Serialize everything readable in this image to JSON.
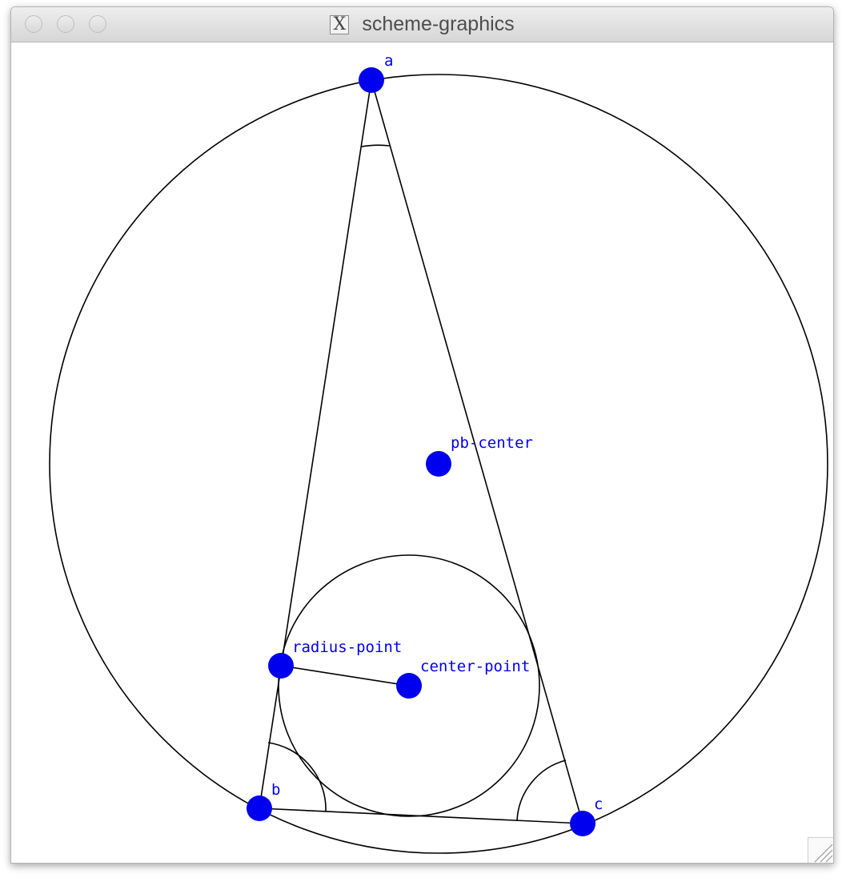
{
  "window": {
    "title": "scheme-graphics"
  },
  "points": {
    "a": "a",
    "b": "b",
    "c": "c",
    "pb_center": "pb-center",
    "radius_point": "radius-point",
    "center_point": "center-point"
  },
  "colors": {
    "point": "#0000ee",
    "stroke": "#000000"
  },
  "icons": {
    "titlebar_app_icon": "x11-icon",
    "resize": "resize-grip-icon"
  }
}
